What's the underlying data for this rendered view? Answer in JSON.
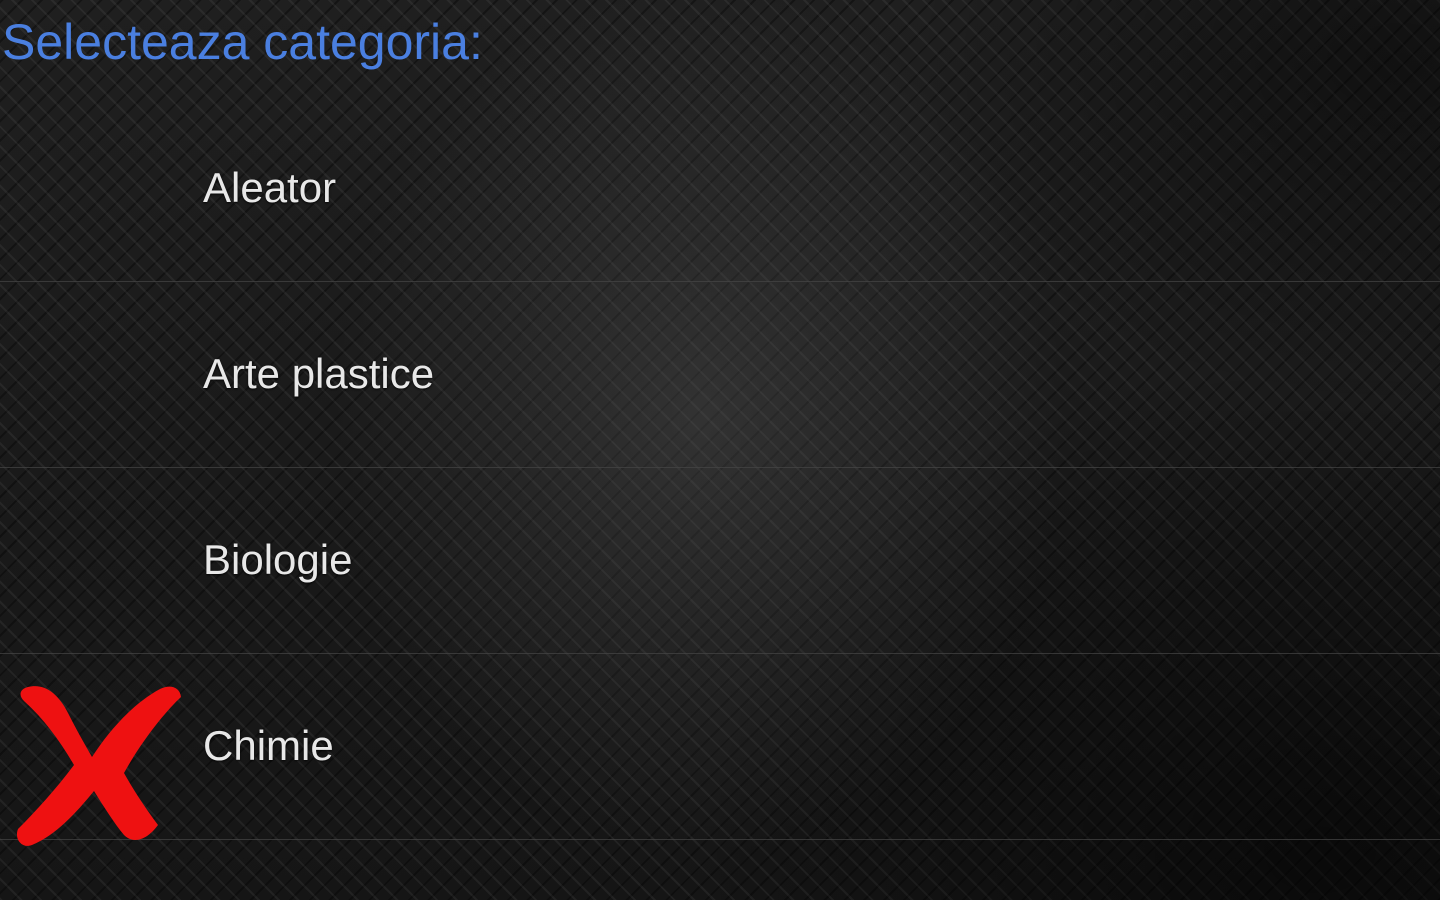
{
  "header": {
    "title": "Selecteaza categoria:",
    "title_color": "#4a7fe0"
  },
  "categories": [
    {
      "label": "Aleator",
      "icon": null
    },
    {
      "label": "Arte plastice",
      "icon": null
    },
    {
      "label": "Biologie",
      "icon": null
    },
    {
      "label": "Chimie",
      "icon": "red-x-icon",
      "icon_color": "#ee1111"
    }
  ]
}
